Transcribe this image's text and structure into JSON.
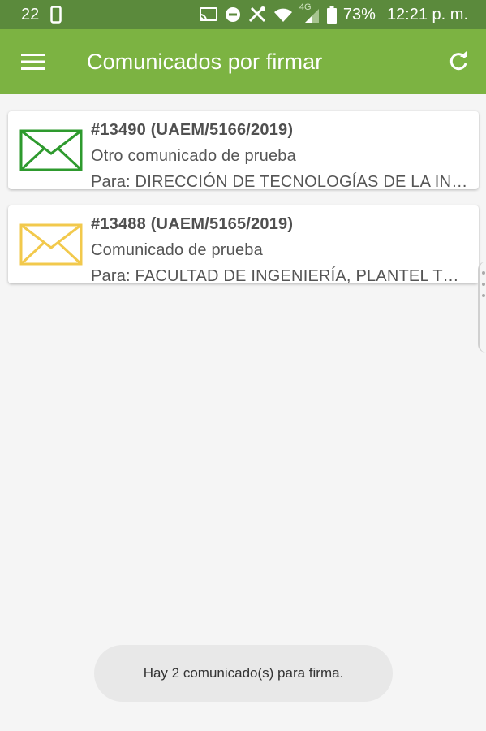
{
  "status_bar": {
    "notification_count": "22",
    "battery_percent": "73%",
    "network_type": "4G",
    "time": "12:21 p. m.",
    "icons": [
      "phone-icon",
      "cast-icon",
      "do-not-disturb-icon",
      "tools-icon",
      "wifi-icon",
      "signal-icon",
      "battery-icon"
    ]
  },
  "app_bar": {
    "title": "Comunicados por firmar",
    "menu_icon": "hamburger-menu-icon",
    "refresh_icon": "refresh-icon",
    "color": "#7cb342"
  },
  "items": [
    {
      "id": "#13490 (UAEM/5166/2019)",
      "subject": "Otro comunicado de prueba",
      "recipient": "Para: DIRECCIÓN DE TECNOLOGÍAS DE LA INFORMACIÓN",
      "icon": "envelope-icon",
      "icon_color": "#2e9a2e"
    },
    {
      "id": "#13488 (UAEM/5165/2019)",
      "subject": "Comunicado de prueba",
      "recipient": "Para: FACULTAD DE INGENIERÍA, PLANTEL TOLUCA",
      "icon": "envelope-icon",
      "icon_color": "#f2c94c"
    }
  ],
  "toast": {
    "message": "Hay 2 comunicado(s) para firma."
  }
}
